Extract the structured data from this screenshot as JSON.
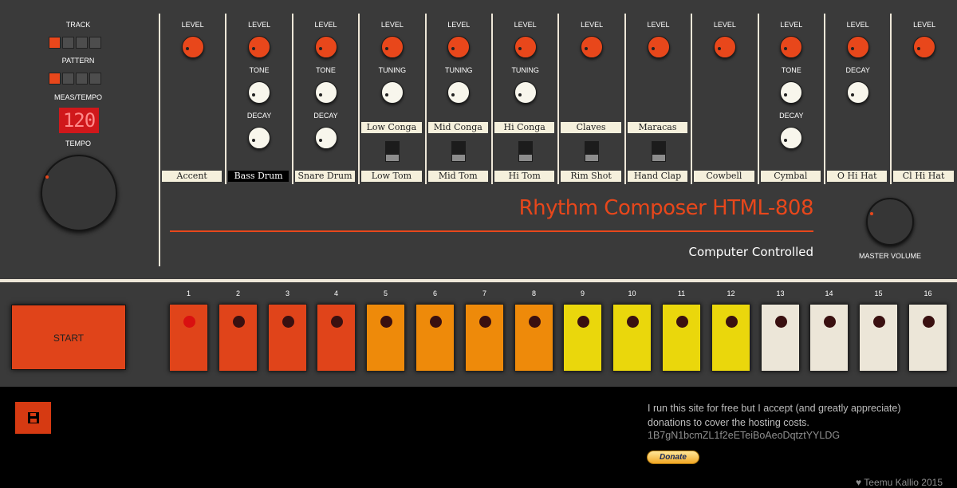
{
  "left_controls": {
    "track_label": "TRACK",
    "pattern_label": "PATTERN",
    "meas_tempo_label": "MEAS/TEMPO",
    "tempo_label": "TEMPO",
    "tempo_value": "120",
    "track_buttons_active": [
      true,
      false,
      false,
      false
    ],
    "pattern_buttons_active": [
      true,
      false,
      false,
      false
    ]
  },
  "instruments": [
    {
      "name": "Accent",
      "knobs": [
        {
          "label": "LEVEL",
          "type": "red"
        }
      ],
      "toggle": null,
      "selected": false
    },
    {
      "name": "Bass Drum",
      "knobs": [
        {
          "label": "LEVEL",
          "type": "red"
        },
        {
          "label": "TONE",
          "type": "white"
        },
        {
          "label": "DECAY",
          "type": "white"
        }
      ],
      "toggle": null,
      "selected": true
    },
    {
      "name": "Snare Drum",
      "knobs": [
        {
          "label": "LEVEL",
          "type": "red"
        },
        {
          "label": "TONE",
          "type": "white"
        },
        {
          "label": "DECAY",
          "type": "white"
        }
      ],
      "toggle": null,
      "selected": false
    },
    {
      "name": "Low Tom",
      "knobs": [
        {
          "label": "LEVEL",
          "type": "red"
        },
        {
          "label": "TUNING",
          "type": "white"
        }
      ],
      "toggle": "Low Conga",
      "selected": false
    },
    {
      "name": "Mid Tom",
      "knobs": [
        {
          "label": "LEVEL",
          "type": "red"
        },
        {
          "label": "TUNING",
          "type": "white"
        }
      ],
      "toggle": "Mid Conga",
      "selected": false
    },
    {
      "name": "Hi Tom",
      "knobs": [
        {
          "label": "LEVEL",
          "type": "red"
        },
        {
          "label": "TUNING",
          "type": "white"
        }
      ],
      "toggle": "Hi Conga",
      "selected": false
    },
    {
      "name": "Rim Shot",
      "knobs": [
        {
          "label": "LEVEL",
          "type": "red"
        }
      ],
      "toggle": "Claves",
      "selected": false
    },
    {
      "name": "Hand Clap",
      "knobs": [
        {
          "label": "LEVEL",
          "type": "red"
        }
      ],
      "toggle": "Maracas",
      "selected": false
    },
    {
      "name": "Cowbell",
      "knobs": [
        {
          "label": "LEVEL",
          "type": "red"
        }
      ],
      "toggle": null,
      "selected": false
    },
    {
      "name": "Cymbal",
      "knobs": [
        {
          "label": "LEVEL",
          "type": "red"
        },
        {
          "label": "TONE",
          "type": "white"
        },
        {
          "label": "DECAY",
          "type": "white"
        }
      ],
      "toggle": null,
      "selected": false
    },
    {
      "name": "O Hi Hat",
      "knobs": [
        {
          "label": "LEVEL",
          "type": "red"
        },
        {
          "label": "DECAY",
          "type": "white"
        }
      ],
      "toggle": null,
      "selected": false
    },
    {
      "name": "Cl Hi Hat",
      "knobs": [
        {
          "label": "LEVEL",
          "type": "red"
        }
      ],
      "toggle": null,
      "selected": false
    }
  ],
  "brand": {
    "title": "Rhythm Composer HTML-808",
    "subtitle": "Computer Controlled",
    "master_volume_label": "MASTER VOLUME"
  },
  "sequencer": {
    "start_label": "START",
    "steps": [
      {
        "number": "1",
        "color": "#e0441a",
        "playing": true
      },
      {
        "number": "2",
        "color": "#e0441a",
        "playing": false
      },
      {
        "number": "3",
        "color": "#e0441a",
        "playing": false
      },
      {
        "number": "4",
        "color": "#e0441a",
        "playing": false
      },
      {
        "number": "5",
        "color": "#ee8a0a",
        "playing": false
      },
      {
        "number": "6",
        "color": "#ee8a0a",
        "playing": false
      },
      {
        "number": "7",
        "color": "#ee8a0a",
        "playing": false
      },
      {
        "number": "8",
        "color": "#ee8a0a",
        "playing": false
      },
      {
        "number": "9",
        "color": "#ead70c",
        "playing": false
      },
      {
        "number": "10",
        "color": "#ead70c",
        "playing": false
      },
      {
        "number": "11",
        "color": "#ead70c",
        "playing": false
      },
      {
        "number": "12",
        "color": "#ead70c",
        "playing": false
      },
      {
        "number": "13",
        "color": "#ece6d8",
        "playing": false
      },
      {
        "number": "14",
        "color": "#ece6d8",
        "playing": false
      },
      {
        "number": "15",
        "color": "#ece6d8",
        "playing": false
      },
      {
        "number": "16",
        "color": "#ece6d8",
        "playing": false
      }
    ]
  },
  "footer": {
    "save_icon": "floppy-disk-icon",
    "donate_text": "I run this site for free but I accept (and greatly appreciate) donations to cover the hosting costs.",
    "btc_address": "1B7gN1bcmZL1f2eETeiBoAeoDqtztYYLDG",
    "donate_button": "Donate",
    "credit": "Teemu Kallio 2015"
  },
  "colors": {
    "panel": "#3a3a3a",
    "accent": "#e8471b",
    "cream": "#eee7d8"
  }
}
